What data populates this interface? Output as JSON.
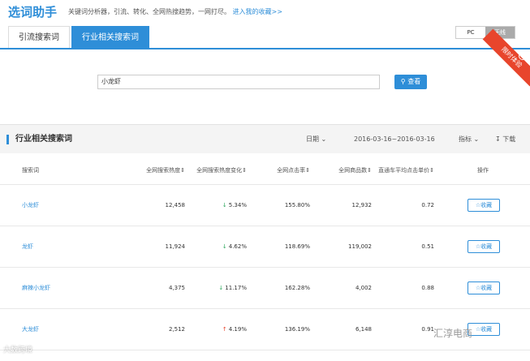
{
  "topbar": {
    "brand": "选词助手",
    "description": "关键词分析器，引流、转化、全网热搜趋势，一网打尽。",
    "link": "进入我的收藏>>"
  },
  "tabs": [
    "引流搜索词",
    "行业相关搜索词"
  ],
  "device_toggle": [
    "PC",
    "无线"
  ],
  "ribbon": "限时体验",
  "search": {
    "value": "小龙虾",
    "button": "查看"
  },
  "panel": {
    "title": "行业相关搜索词",
    "date_label": "日期",
    "date_range": "2016-03-16~2016-03-16",
    "metric_label": "指标",
    "download": "下载"
  },
  "table": {
    "headers": [
      "搜索词",
      "全网搜索热度",
      "全网搜索热度变化",
      "全网点击率",
      "全网商品数",
      "直通车平均点击单价",
      "操作"
    ],
    "fav_label": "收藏",
    "rows": [
      {
        "keyword": "小龙虾",
        "heat": "12,458",
        "change": "5.34%",
        "trend": "down",
        "ctr": "155.80%",
        "goods": "12,932",
        "cpc": "0.72"
      },
      {
        "keyword": "龙虾",
        "heat": "11,924",
        "change": "4.62%",
        "trend": "down",
        "ctr": "118.69%",
        "goods": "119,002",
        "cpc": "0.51"
      },
      {
        "keyword": "麻辣小龙虾",
        "heat": "4,375",
        "change": "11.17%",
        "trend": "down",
        "ctr": "162.28%",
        "goods": "4,002",
        "cpc": "0.88"
      },
      {
        "keyword": "大龙虾",
        "heat": "2,512",
        "change": "4.19%",
        "trend": "up",
        "ctr": "136.19%",
        "goods": "6,148",
        "cpc": "0.91"
      }
    ]
  },
  "watermarks": [
    "大数跨境",
    "汇淳电商"
  ]
}
